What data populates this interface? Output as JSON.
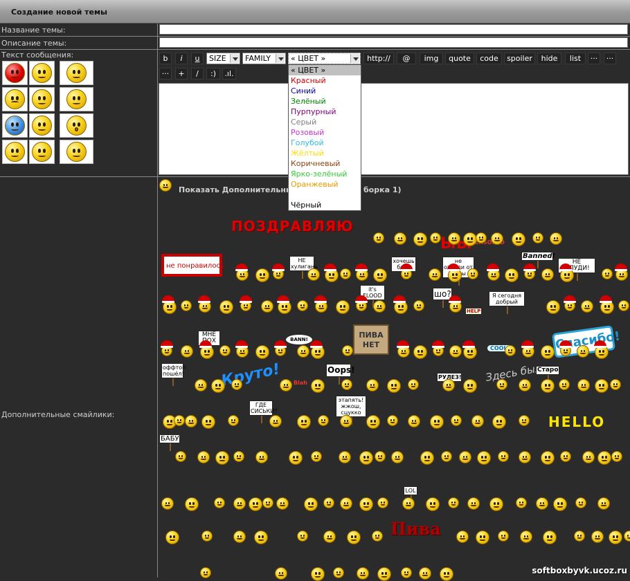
{
  "header": {
    "title": "Создание новой темы"
  },
  "form": {
    "name_label": "Название темы:",
    "name_value": "",
    "desc_label": "Описание темы:",
    "desc_value": "",
    "message_label": "Текст сообщения:",
    "extra_label": "Дополнительные смайлики:"
  },
  "toolbar": {
    "bold": "b",
    "italic": "i",
    "underline": "u",
    "size_select": "SIZE",
    "family_select": "FAMILY",
    "color_select": "« ЦВЕТ »",
    "url": "http://",
    "email": "@",
    "img": "img",
    "quote": "quote",
    "code": "code",
    "spoiler": "spoiler",
    "hide": "hide",
    "list": "list",
    "dots1": "···",
    "dots2": "···",
    "dots3": "···",
    "plus": "+",
    "slash": "/",
    "smile": ":)",
    "bars": ".ıl."
  },
  "color_dropdown": {
    "options": [
      {
        "label": "« ЦВЕТ »",
        "color": "#000000"
      },
      {
        "label": "Красный",
        "color": "#cc0000"
      },
      {
        "label": "Синий",
        "color": "#0000aa"
      },
      {
        "label": "Зелёный",
        "color": "#008000"
      },
      {
        "label": "Пурпурный",
        "color": "#800080"
      },
      {
        "label": "Серый",
        "color": "#808080"
      },
      {
        "label": "Розовый",
        "color": "#cc33cc"
      },
      {
        "label": "Голубой",
        "color": "#33bbdd"
      },
      {
        "label": "Жёлтый",
        "color": "#ffdd00"
      },
      {
        "label": "Коричневый",
        "color": "#8b4513"
      },
      {
        "label": "Ярко-зелёный",
        "color": "#33cc33"
      },
      {
        "label": "Оранжевый",
        "color": "#e69c00"
      },
      {
        "label": "",
        "color": "#ffffff"
      },
      {
        "label": "Чёрный",
        "color": "#000000"
      }
    ]
  },
  "extra": {
    "show_more": "Показать Дополнительные",
    "show_more_tail": "борка 1)"
  },
  "stickers": {
    "congrats": "ПОЗДРАВЛЯЮ",
    "ne_ponravilos": "не понравилось",
    "censored": "CENSORED",
    "ne_hulignan": "НЕ хулигань",
    "hochesh_ban": "хочешь бан?",
    "ne_othodi": "не отходи от темы",
    "banned": "Banned!",
    "ne_flood": "НЕ ФЛУДИ!",
    "its_flood": "it's FLOOD",
    "sho": "шо?",
    "help": "HELP",
    "ya_segodnya": "Я сегодня добрый",
    "mne_poh": "МНЕ ПОХ",
    "bann": "BANN!",
    "piva_net": "ПИВА НЕТ",
    "cool": "COOL!",
    "spasibo": "Спасибо!",
    "offtop": "оффтоп пошёл!",
    "kruto": "Круто!",
    "blah": "Blah",
    "oops": "Oops!",
    "rules": "РУЛЕЗ!",
    "zdes_byl": "Здесь был",
    "staro": "Старо",
    "gde_siski": "ГДЕ СИСЬКИ?",
    "etapyat": "этапять! жжош, сцукко",
    "hello": "HELLO",
    "babu": "БАБУ",
    "lol": "LOL",
    "piva": "Пива"
  },
  "watermark": "softboxbyvk.ucoz.ru"
}
